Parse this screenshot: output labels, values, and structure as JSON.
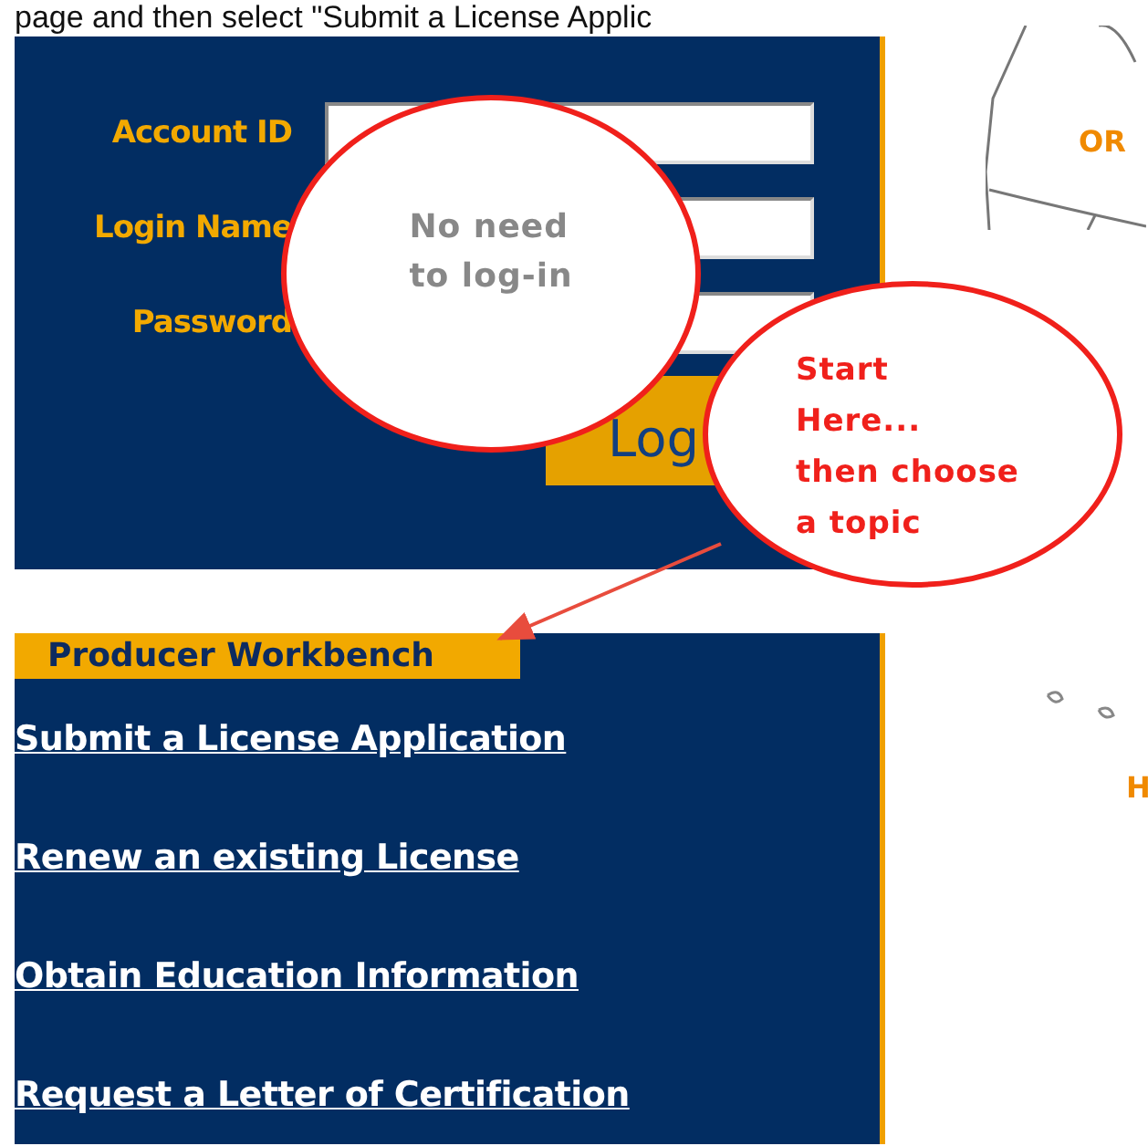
{
  "instruction_text": "page and then select \"Submit a License Applic",
  "login": {
    "fields": [
      {
        "label": "Account ID"
      },
      {
        "label": "Login Name"
      },
      {
        "label": "Password"
      }
    ],
    "button": "Log"
  },
  "map": {
    "labels": [
      "OR",
      "H"
    ]
  },
  "workbench": {
    "title": "Producer Workbench",
    "links": [
      "Submit a License Application",
      "Renew an existing License",
      "Obtain Education Information",
      "Request a Letter of Certification"
    ]
  },
  "callouts": [
    {
      "kind": "note",
      "text": "No need\nto log-in"
    },
    {
      "kind": "pointer",
      "text": "Start\nHere...\nthen choose\na topic"
    }
  ]
}
